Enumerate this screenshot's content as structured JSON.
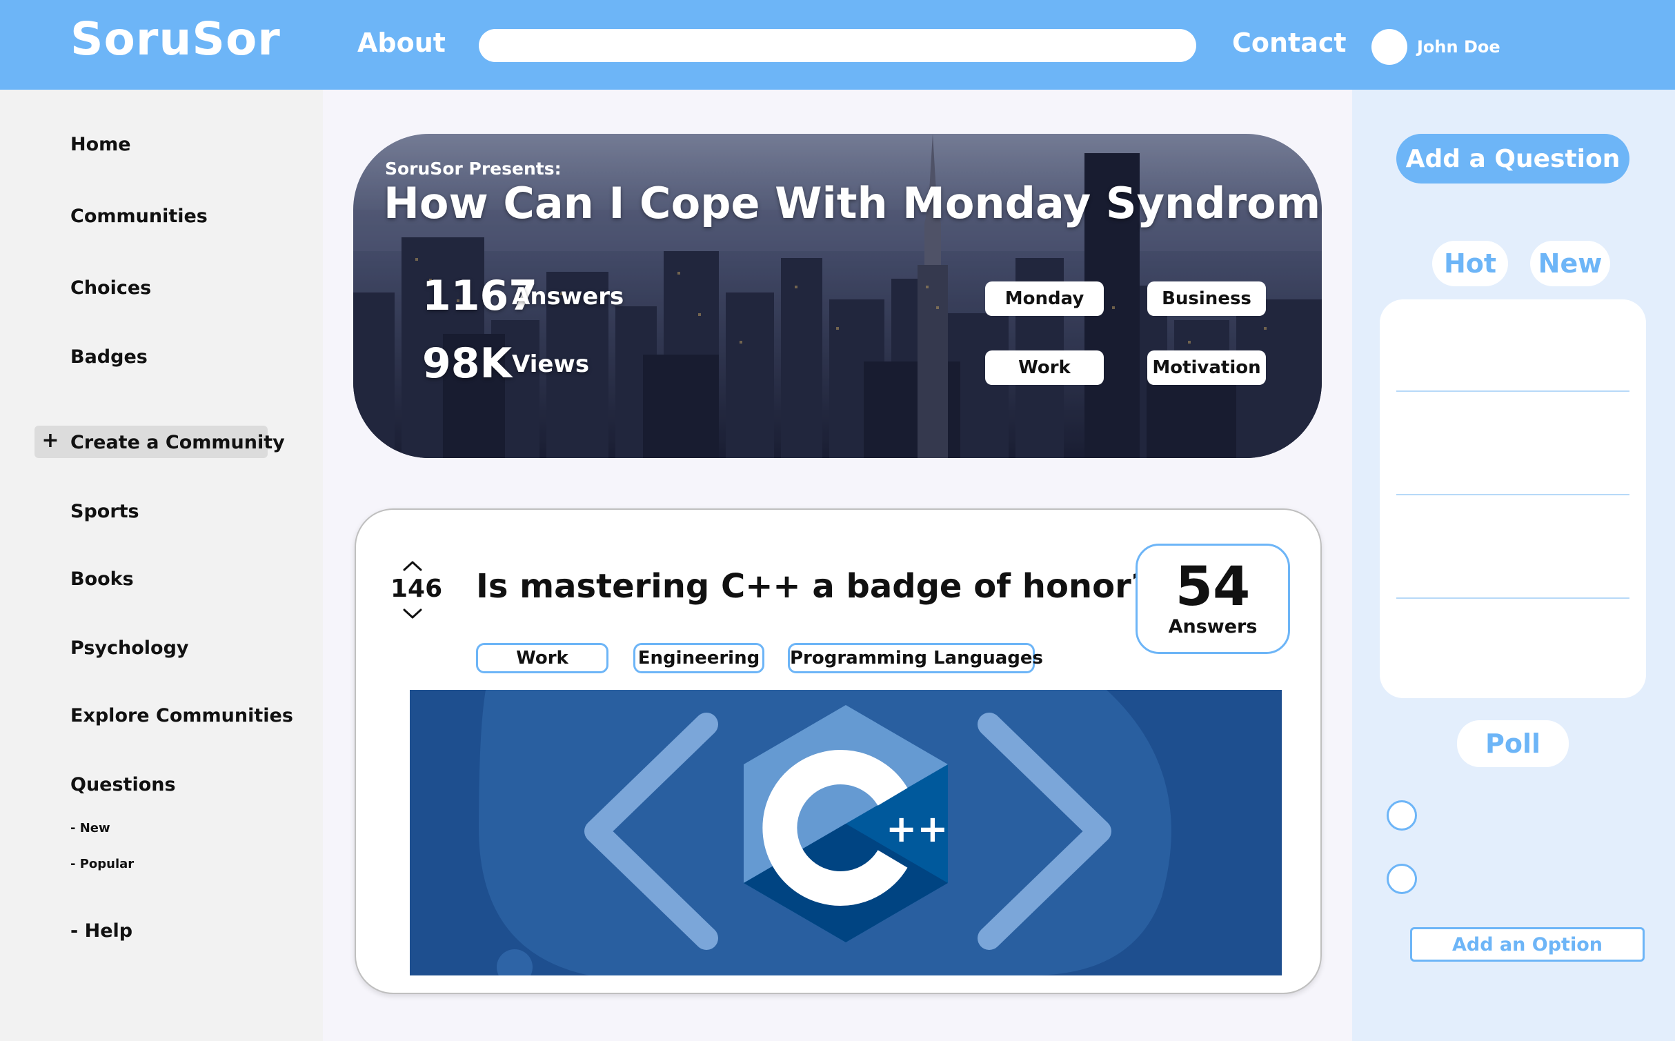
{
  "header": {
    "logo": "SoruSor",
    "nav_about": "About",
    "search": {
      "value": "",
      "placeholder": ""
    },
    "nav_contact": "Contact",
    "user_name": "John Doe"
  },
  "sidebar": {
    "items": [
      {
        "label": "Home"
      },
      {
        "label": "Communities"
      },
      {
        "label": "Choices"
      },
      {
        "label": "Badges"
      },
      {
        "label": "Sports"
      },
      {
        "label": "Books"
      },
      {
        "label": "Psychology"
      },
      {
        "label": "Explore Communities"
      },
      {
        "label": "Questions"
      }
    ],
    "create_community": "Create a Community",
    "create_icon": "plus-icon",
    "question_sub": [
      "- New",
      "- Popular"
    ],
    "help": "- Help"
  },
  "banner": {
    "presents": "SoruSor Presents:",
    "title": "How Can I Cope With Monday Syndrome?",
    "answers_count": "1167",
    "answers_label": "Answers",
    "views_count": "98K",
    "views_label": "Views",
    "tags": [
      "Monday",
      "Business",
      "Work",
      "Motivation"
    ]
  },
  "question": {
    "votes": "146",
    "title": "Is mastering C++ a badge of honor?",
    "answers_count": "54",
    "answers_label": "Answers",
    "tags": [
      "Work",
      "Engineering",
      "Programming Languages"
    ],
    "image_label": "++",
    "image_icon": "cpp-logo-icon"
  },
  "right_panel": {
    "add_question": "Add a Question",
    "hot": "Hot",
    "new": "New",
    "poll": "Poll",
    "add_option": "Add an Option"
  },
  "colors": {
    "accent": "#6db5f7",
    "sidebar_bg": "#f2f2f2",
    "right_bg": "#e3eefc",
    "main_bg": "#f6f5fb"
  }
}
